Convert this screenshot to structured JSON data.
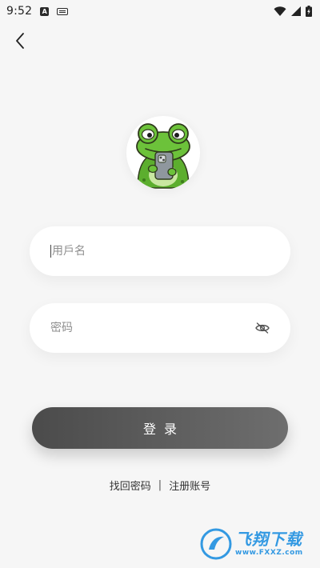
{
  "status_bar": {
    "time": "9:52",
    "notif_a_label": "A"
  },
  "icons": {
    "back": "chevron-left-icon",
    "eye": "eye-off-icon",
    "wifi": "wifi-icon",
    "signal": "signal-icon",
    "battery": "battery-charging-icon",
    "avatar": "frog-logo"
  },
  "form": {
    "username_placeholder": "用戶名",
    "password_placeholder": "密码",
    "login_label": "登录"
  },
  "links": {
    "find_password": "找回密码",
    "separator": "|",
    "register": "注册账号"
  },
  "watermark": {
    "text": "飞翔下载",
    "url": "www.FXXZ.com"
  },
  "colors": {
    "background": "#f6f6f6",
    "button_start": "#4b4b4b",
    "button_end": "#6e6e6e",
    "watermark_blue": "#1e8fe0"
  }
}
